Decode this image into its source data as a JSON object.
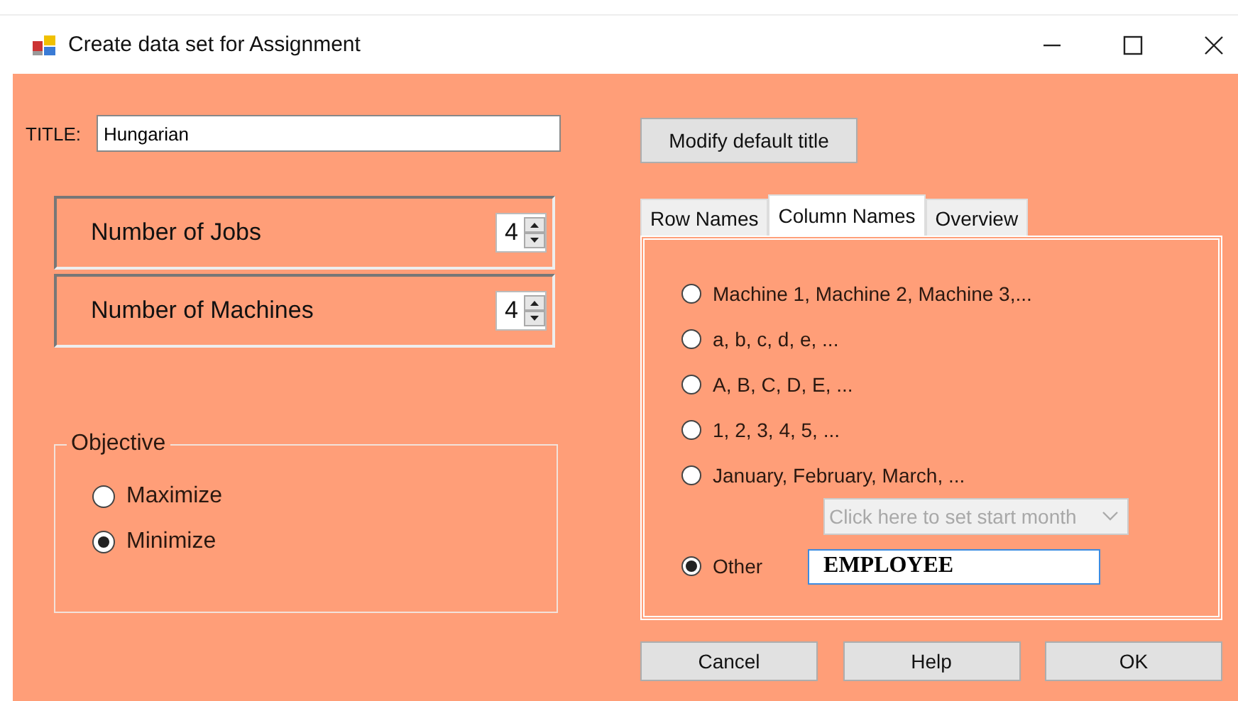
{
  "window": {
    "title": "Create data set for Assignment"
  },
  "title_field": {
    "label": "TITLE:",
    "value": "Hungarian"
  },
  "spinners": [
    {
      "label": "Number of Jobs",
      "value": "4"
    },
    {
      "label": "Number of Machines",
      "value": "4"
    }
  ],
  "objective": {
    "legend": "Objective",
    "options": [
      {
        "label": "Maximize",
        "selected": false
      },
      {
        "label": "Minimize",
        "selected": true
      }
    ]
  },
  "modify_button": "Modify default title",
  "tabs": [
    {
      "label": "Row Names",
      "selected": false
    },
    {
      "label": "Column Names",
      "selected": true
    },
    {
      "label": "Overview",
      "selected": false
    }
  ],
  "column_names": {
    "options": [
      {
        "label": "Machine 1, Machine 2, Machine 3,...",
        "selected": false
      },
      {
        "label": "a, b, c, d, e, ...",
        "selected": false
      },
      {
        "label": "A, B, C, D, E, ...",
        "selected": false
      },
      {
        "label": "1, 2, 3, 4, 5, ...",
        "selected": false
      },
      {
        "label": "January, February, March, ...",
        "selected": false,
        "month_combo": {
          "text": "Click here to set start month",
          "disabled": true
        }
      },
      {
        "label": "Other",
        "selected": true,
        "text_field": {
          "value": "EMPLOYEE"
        }
      }
    ]
  },
  "buttons": [
    "Cancel",
    "Help",
    "OK"
  ]
}
